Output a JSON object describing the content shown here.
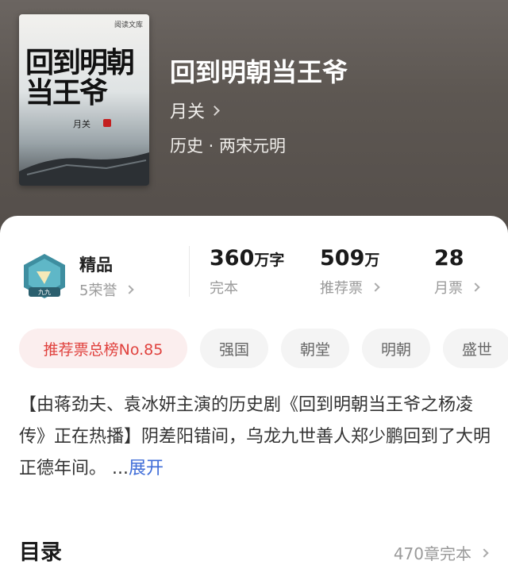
{
  "book": {
    "title": "回到明朝当王爷",
    "author": "月关",
    "genre": "历史 · 两宋元明",
    "cover": {
      "title": "回到明朝当王爷",
      "author": "月关",
      "publisher": "阅读文库"
    }
  },
  "honor": {
    "title": "精品",
    "count": "5荣誉",
    "badge_text": "九九"
  },
  "stats": {
    "words": {
      "num": "360",
      "unit": "万字",
      "label": "完本"
    },
    "recommend": {
      "num": "509",
      "unit": "万",
      "label": "推荐票"
    },
    "monthly": {
      "num": "28",
      "unit": "",
      "label": "月票"
    }
  },
  "tags": [
    "推荐票总榜No.85",
    "强国",
    "朝堂",
    "明朝",
    "盛世"
  ],
  "description": {
    "text": "【由蒋劲夫、袁冰妍主演的历史剧《回到明朝当王爷之杨凌传》正在热播】阴差阳错间，乌龙九世善人郑少鹏回到了大明正德年间。 ...",
    "more": "展开"
  },
  "toc": {
    "title": "目录",
    "summary": "470章完本"
  },
  "colors": {
    "accent_blue": "#3f6dd8",
    "rank_red": "#e0413d"
  }
}
